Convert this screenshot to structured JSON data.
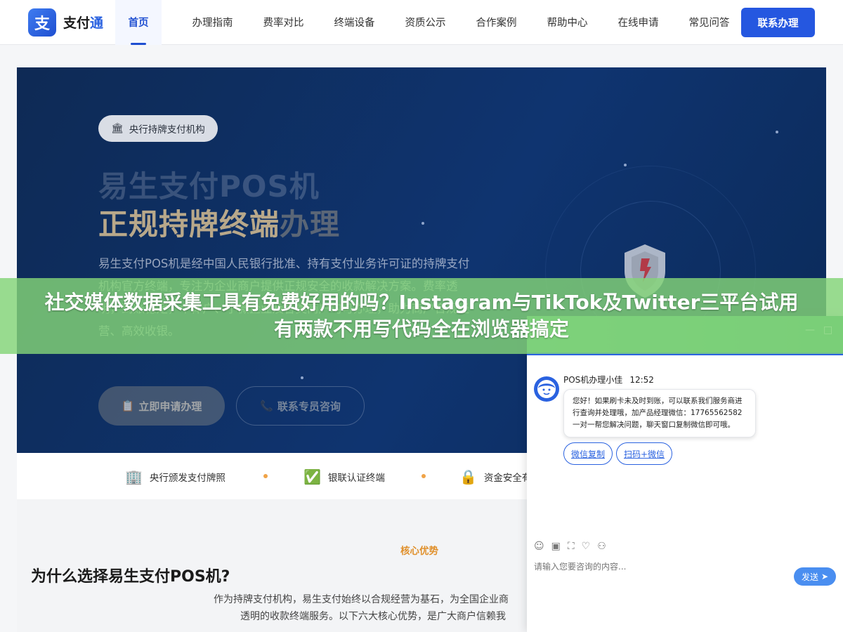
{
  "brand": {
    "mark": "支",
    "name": "支付",
    "accent": "通"
  },
  "nav": {
    "items": [
      {
        "label": "首页",
        "active": true
      },
      {
        "label": "办理指南"
      },
      {
        "label": "费率对比"
      },
      {
        "label": "终端设备"
      },
      {
        "label": "资质公示"
      },
      {
        "label": "合作案例"
      },
      {
        "label": "帮助中心"
      },
      {
        "label": "在线申请"
      },
      {
        "label": "常见问答"
      }
    ],
    "cta": "联系办理"
  },
  "hero": {
    "badge": "央行持牌支付机构",
    "title1": "易生支付POS机",
    "title2_strong": "正规持牌终端",
    "title2_dim": "办理",
    "desc": "易生支付POS机是经中国人民银行批准、持有支付业务许可证的持牌支付机构官方终端，专注为企业商户提供正规安全的收款解决方案。费率透明，到账稳定，个体户、小微企业及各类商户均可办理，助力商户合规经营、高效收银。",
    "btn_primary": "立即申请办理",
    "btn_secondary": "联系专员咨询"
  },
  "trust": {
    "items": [
      {
        "icon": "building-icon",
        "label": "央行颁发支付牌照"
      },
      {
        "icon": "check-icon",
        "label": "银联认证终端"
      },
      {
        "icon": "lock-icon",
        "label": "资金安全有"
      }
    ]
  },
  "why": {
    "kicker": "核心优势",
    "title": "为什么选择易生支付POS机?",
    "p1": "作为持牌支付机构，易生支付始终以合规经营为基石，为全国企业商",
    "p2": "透明的收款终端服务。以下六大核心优势，是广大商户信赖我"
  },
  "banner": {
    "text": "社交媒体数据采集工具有免费好用的吗？Instagram与TikTok及Twitter三平台试用有两款不用写代码全在浏览器搞定"
  },
  "chat": {
    "agent": "POS机办理小佳",
    "time": "12:52",
    "message": "您好！如果刷卡未及时到账，可以联系我们服务商进行查询并处理哦，加产品经理微信：17765562582 一对一帮您解决问题，聊天窗口复制微信即可哦。",
    "quick1": "微信复制",
    "quick2": "扫码+微信",
    "placeholder": "请输入您要咨询的内容...",
    "send": "发送",
    "minimize": "—",
    "maximize": "□"
  },
  "colors": {
    "primary": "#2557e0",
    "hero_bg": "#0f3470",
    "banner": "#84d478",
    "accent": "#e0902c"
  }
}
